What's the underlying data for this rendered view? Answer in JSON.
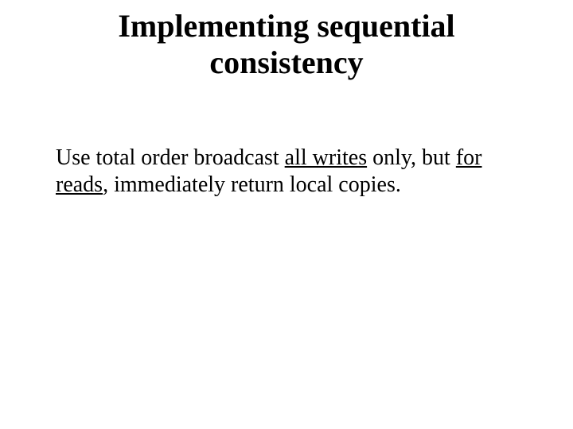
{
  "title_line1": "Implementing sequential",
  "title_line2": "consistency",
  "body": {
    "pre_all_writes": "Use total order broadcast ",
    "all_writes": "all writes",
    "between": " only, but ",
    "for_reads": "for reads",
    "post_for_reads": ", immediately return local copies."
  }
}
